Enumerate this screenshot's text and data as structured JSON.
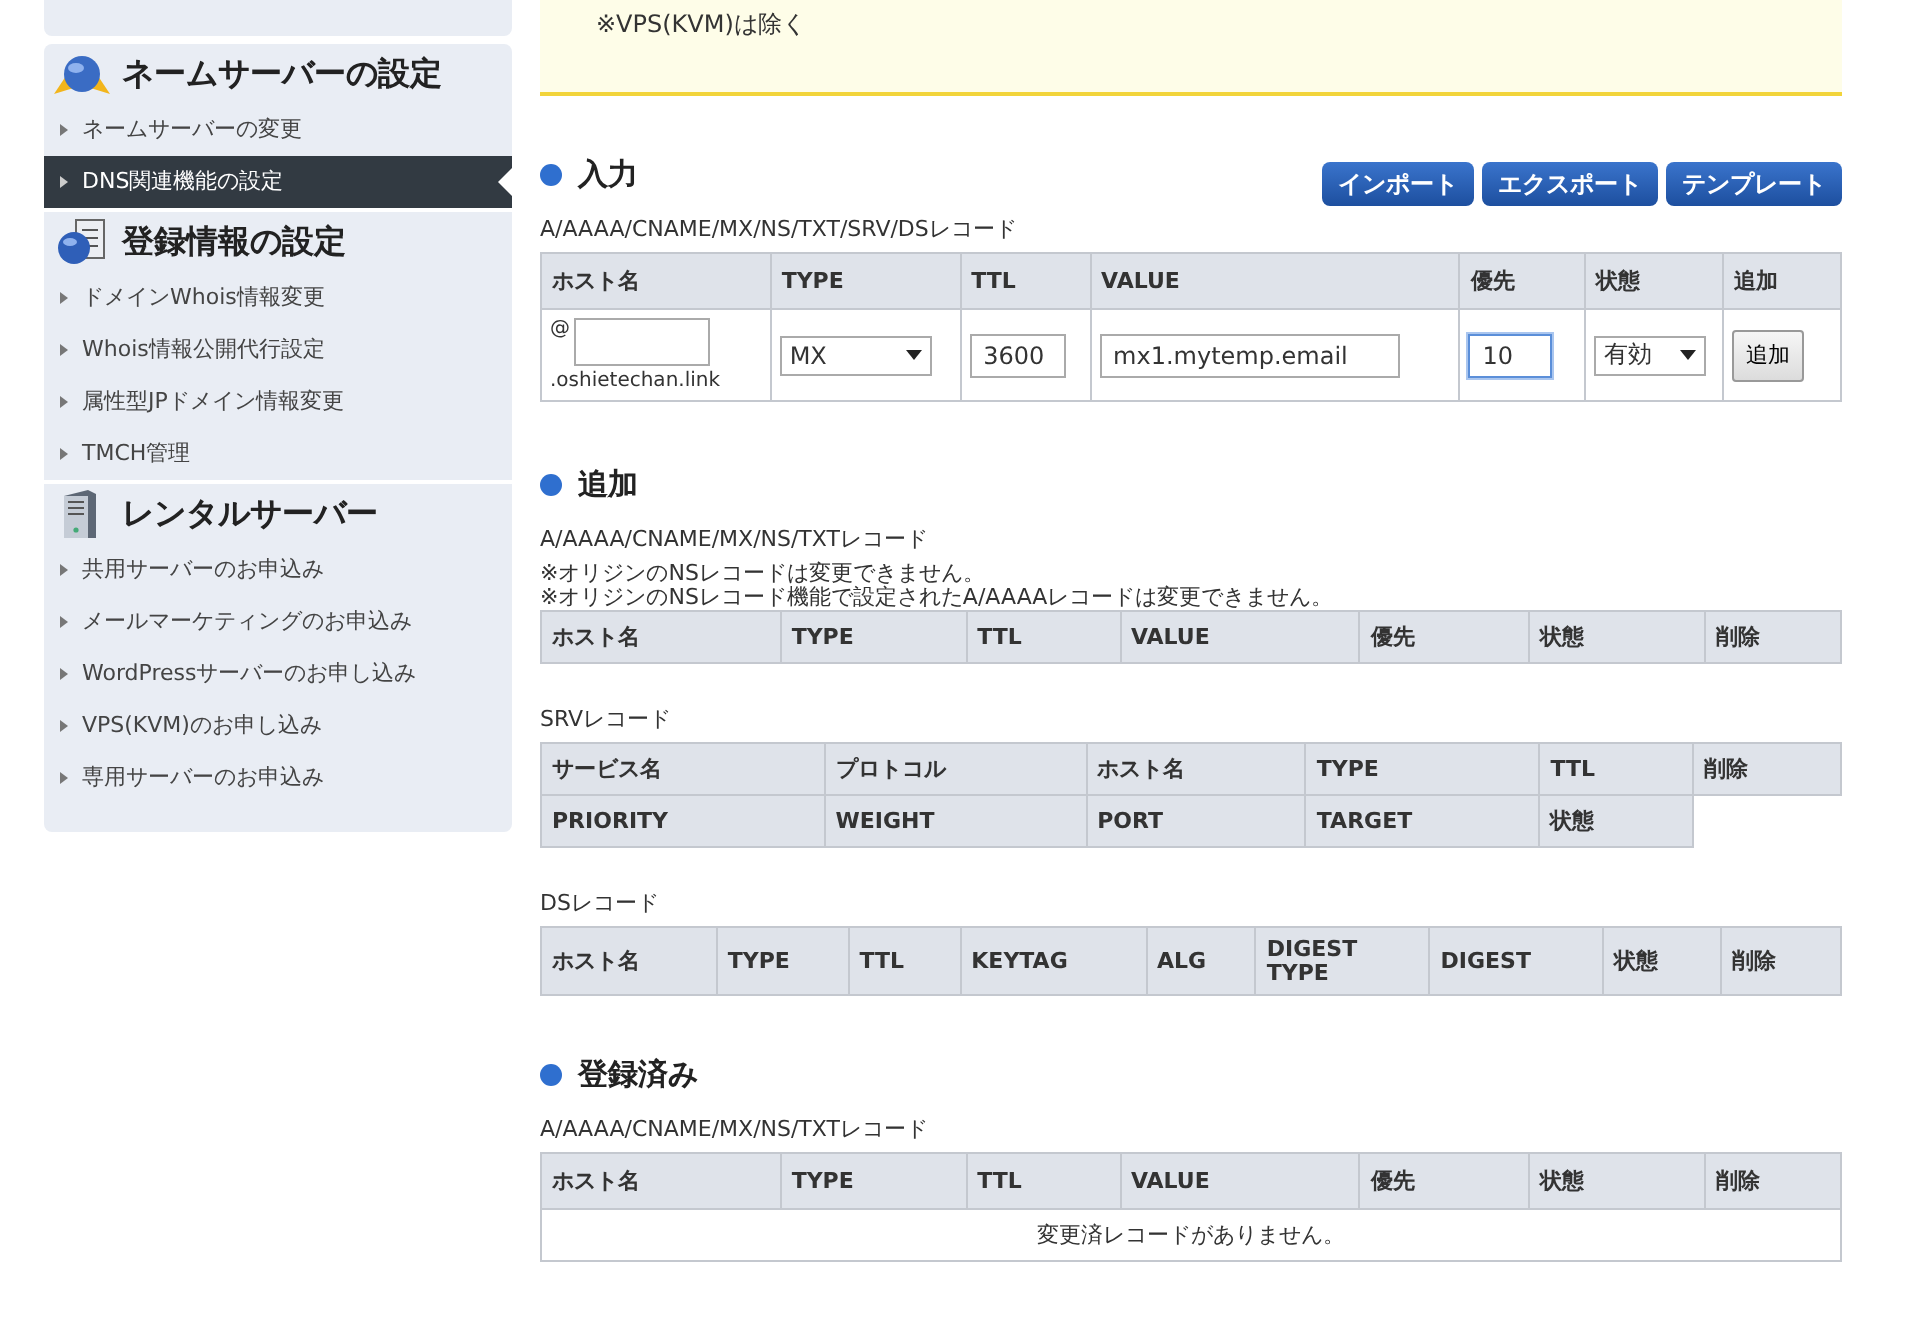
{
  "sidebar": {
    "sections": [
      {
        "title": "ネームサーバーの設定",
        "items": [
          {
            "label": "ネームサーバーの変更",
            "selected": false
          },
          {
            "label": "DNS関連機能の設定",
            "selected": true
          }
        ]
      },
      {
        "title": "登録情報の設定",
        "items": [
          {
            "label": "ドメインWhois情報変更",
            "selected": false
          },
          {
            "label": "Whois情報公開代行設定",
            "selected": false
          },
          {
            "label": "属性型JPドメイン情報変更",
            "selected": false
          },
          {
            "label": "TMCH管理",
            "selected": false
          }
        ]
      },
      {
        "title": "レンタルサーバー",
        "items": [
          {
            "label": "共用サーバーのお申込み",
            "selected": false
          },
          {
            "label": "メールマーケティングのお申込み",
            "selected": false
          },
          {
            "label": "WordPressサーバーのお申し込み",
            "selected": false
          },
          {
            "label": "VPS(KVM)のお申し込み",
            "selected": false
          },
          {
            "label": "専用サーバーのお申込み",
            "selected": false
          }
        ]
      }
    ]
  },
  "notice": "※VPS(KVM)は除く",
  "input": {
    "title": "入力",
    "buttons": [
      "インポート",
      "エクスポート",
      "テンプレート"
    ],
    "record_label": "A/AAAA/CNAME/MX/NS/TXT/SRV/DSレコード",
    "columns": [
      "ホスト名",
      "TYPE",
      "TTL",
      "VALUE",
      "優先",
      "状態",
      "追加"
    ],
    "row": {
      "host_prefix": "@",
      "domain": ".oshietechan.link",
      "type": "MX",
      "ttl": "3600",
      "value": "mx1.mytemp.email",
      "priority": "10",
      "status": "有効",
      "add_button": "追加"
    }
  },
  "add": {
    "title": "追加",
    "tables": [
      {
        "label": "A/AAAA/CNAME/MX/NS/TXTレコード",
        "notes": [
          "※オリジンのNSレコードは変更できません。",
          "※オリジンのNSレコード機能で設定されたA/AAAAレコードは変更できません。"
        ],
        "header_rows": [
          [
            "ホスト名",
            "TYPE",
            "TTL",
            "VALUE",
            "優先",
            "状態",
            "削除"
          ]
        ]
      },
      {
        "label": "SRVレコード",
        "header_rows": [
          [
            "サービス名",
            "プロトコル",
            "ホスト名",
            "TYPE",
            "TTL",
            "削除"
          ],
          [
            "PRIORITY",
            "WEIGHT",
            "PORT",
            "TARGET",
            "状態"
          ]
        ]
      },
      {
        "label": "DSレコード",
        "header_rows": [
          [
            "ホスト名",
            "TYPE",
            "TTL",
            "KEYTAG",
            "ALG",
            "DIGEST TYPE",
            "DIGEST",
            "状態",
            "削除"
          ]
        ]
      }
    ]
  },
  "registered": {
    "title": "登録済み",
    "record_label": "A/AAAA/CNAME/MX/NS/TXTレコード",
    "columns": [
      "ホスト名",
      "TYPE",
      "TTL",
      "VALUE",
      "優先",
      "状態",
      "削除"
    ],
    "empty_message": "変更済レコードがありません。"
  }
}
